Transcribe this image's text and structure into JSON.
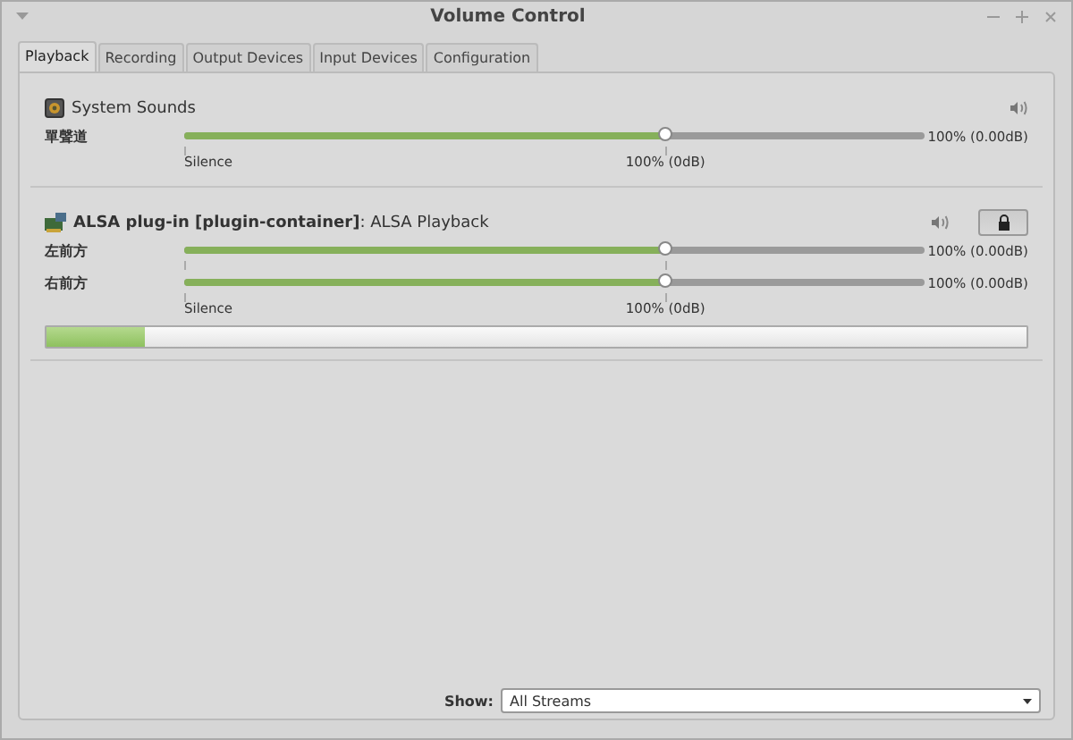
{
  "window": {
    "title": "Volume Control"
  },
  "tabs": [
    {
      "label": "Playback",
      "selected": true
    },
    {
      "label": "Recording",
      "selected": false
    },
    {
      "label": "Output Devices",
      "selected": false
    },
    {
      "label": "Input Devices",
      "selected": false
    },
    {
      "label": "Configuration",
      "selected": false
    }
  ],
  "streams": [
    {
      "kind": "system",
      "name": "System Sounds",
      "channels": [
        {
          "label": "單聲道",
          "level": 0.65,
          "reading": "100% (0.00dB)"
        }
      ],
      "scale": {
        "low": "Silence",
        "mark": "100% (0dB)"
      }
    },
    {
      "kind": "app",
      "name": "**ALSA plug-in [plugin-container]**: ALSA Playback",
      "locked": true,
      "channels": [
        {
          "label": "左前方",
          "level": 0.65,
          "reading": "100% (0.00dB)"
        },
        {
          "label": "右前方",
          "level": 0.65,
          "reading": "100% (0.00dB)"
        }
      ],
      "scale": {
        "low": "Silence",
        "mark": "100% (0dB)"
      },
      "meter": {
        "level": 0.1
      }
    }
  ],
  "show": {
    "label": "Show:",
    "value": "All Streams"
  }
}
